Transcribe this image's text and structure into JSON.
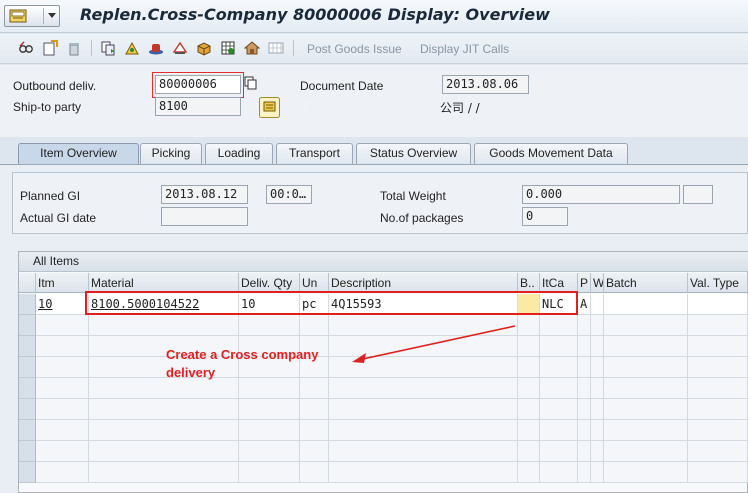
{
  "window": {
    "title": "Replen.Cross-Company 80000006 Display: Overview"
  },
  "toolbar": {
    "icons": [
      "glasses-icon",
      "new-document-icon",
      "trash-icon",
      "copy-items-icon",
      "picking-icon",
      "hat-icon",
      "transport-icon",
      "package-icon",
      "grid-icon",
      "warehouse-icon",
      "options-grid-icon"
    ],
    "post_goods_issue": "Post Goods Issue",
    "display_jit_calls": "Display JIT Calls"
  },
  "header": {
    "outbound_deliv_label": "Outbound deliv.",
    "outbound_deliv_value": "80000006",
    "document_date_label": "Document Date",
    "document_date_value": "2013.08.06",
    "ship_to_label": "Ship-to party",
    "ship_to_value": "8100",
    "ship_to_text": "公司 / /"
  },
  "tabs": [
    {
      "label": "Item Overview",
      "active": true
    },
    {
      "label": "Picking",
      "active": false
    },
    {
      "label": "Loading",
      "active": false
    },
    {
      "label": "Transport",
      "active": false
    },
    {
      "label": "Status Overview",
      "active": false
    },
    {
      "label": "Goods Movement Data",
      "active": false
    }
  ],
  "item_overview": {
    "planned_gi_label": "Planned GI",
    "planned_gi_date": "2013.08.12",
    "planned_gi_time": "00:0…",
    "actual_gi_label": "Actual GI date",
    "actual_gi_value": "",
    "total_weight_label": "Total Weight",
    "total_weight_value": "0.000",
    "total_weight_unit": "",
    "packages_label": "No.of packages",
    "packages_value": "0"
  },
  "items_table": {
    "title": "All Items",
    "columns": [
      "Itm",
      "Material",
      "Deliv. Qty",
      "Un",
      "Description",
      "B..",
      "ItCa",
      "P",
      "W",
      "Batch",
      "Val. Type"
    ],
    "rows": [
      {
        "itm": "10",
        "material": "8100.5000104522",
        "qty": "10",
        "un": "pc",
        "description": "4Q15593",
        "b": "",
        "itca": "NLC",
        "p": "A",
        "w": "",
        "batch": "",
        "valtype": ""
      }
    ]
  },
  "annotation": {
    "line1": "Create a Cross company",
    "line2": "delivery",
    "color": "#e02020"
  },
  "colors": {
    "highlight": "#e0201e",
    "background": "#dfe6ee"
  }
}
